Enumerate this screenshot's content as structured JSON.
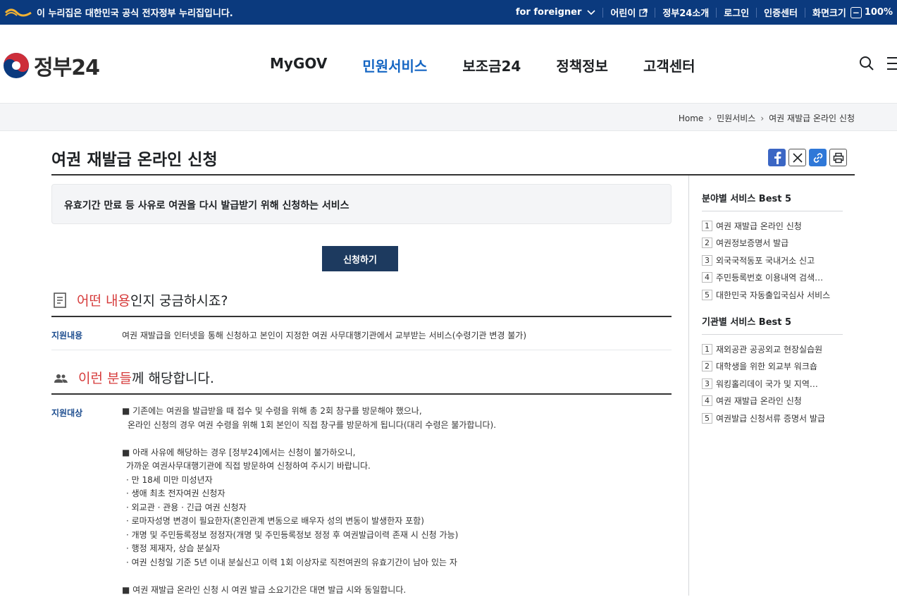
{
  "topbar": {
    "notice": "이 누리집은 대한민국 공식 전자정부 누리집입니다.",
    "for_foreigner": "for foreigner",
    "kids": "어린이",
    "about": "정부24소개",
    "login": "로그인",
    "cert": "인증센터",
    "screen_size": "화면크기",
    "zoom": "100%"
  },
  "header": {
    "logo_text": "정부24",
    "menus": [
      "MyGOV",
      "민원서비스",
      "보조금24",
      "정책정보",
      "고객센터"
    ],
    "active_menu": "민원서비스"
  },
  "breadcrumb": [
    "Home",
    "민원서비스",
    "여권 재발급 온라인 신청"
  ],
  "page": {
    "title": "여권 재발급 온라인 신청",
    "summary": "유효기간 만료 등 사유로 여권을 다시 발급받기 위해 신청하는 서비스",
    "apply_button": "신청하기"
  },
  "section1": {
    "head_hl": "어떤 내용",
    "head_rest": "인지 궁금하시죠?",
    "label": "지원내용",
    "text": "여권 재발급을 인터넷을 통해 신청하고 본인이 지정한 여권 사무대행기관에서 교부받는 서비스(수령기관 변경 불가)"
  },
  "section2": {
    "head_hl": "이런 분들",
    "head_rest": "께 해당합니다.",
    "label": "지원대상",
    "lines": [
      "■ 기존에는 여권을 발급받을 때 접수 및 수령을 위해 총 2회 창구를 방문해야 했으나,",
      "  온라인 신청의 경우 여권 수령을 위해 1회 본인이 직접 창구를 방문하게 됩니다(대리 수령은 불가합니다).",
      "",
      "■ 아래 사유에 해당하는 경우 [정부24]에서는 신청이 불가하오니,",
      "  가까운 여권사무대행기관에 직접 방문하여 신청하여 주시기 바랍니다.",
      "  · 만 18세 미만 미성년자",
      "  · 생애 최초 전자여권 신청자",
      "  · 외교관 · 관용 · 긴급 여권 신청자",
      "  · 로마자성명 변경이 필요한자(혼인관계 변동으로 배우자 성의 변동이 발생한자 포함)",
      "  · 개명 및 주민등록정보 정정자(개명 및 주민등록정보 정정 후 여권발급이력 존재 시 신청 가능)",
      "  · 행정 제재자, 상습 분실자",
      "  · 여권 신청일 기준 5년 이내 분실신고 이력 1회 이상자로 직전여권의 유효기간이 남아 있는 자",
      "",
      "■ 여권 재발급 온라인 신청 시 여권 발급 소요기간은 대면 발급 시와 동일합니다."
    ]
  },
  "side": {
    "best_field_title": "분야별 서비스 Best 5",
    "best_field": [
      "여권 재발급 온라인 신청",
      "여권정보증명서 발급",
      "외국국적동포 국내거소 신고",
      "주민등록번호 이용내역 검색서비스",
      "대한민국 자동출입국심사 서비스"
    ],
    "best_org_title": "기관별 서비스 Best 5",
    "best_org": [
      "재외공관 공공외교 현장실습원",
      "대학생을 위한 외교부 워크숍",
      "워킹홀리데이 국가 및 지역별 정보",
      "여권 재발급 온라인 신청",
      "여권발급 신청서류 증명서 발급"
    ]
  },
  "colors": {
    "topbar": "#0b3a7e",
    "active_menu": "#1566c3",
    "highlight": "#d63b3b",
    "apply_button": "#1d3a5f"
  }
}
